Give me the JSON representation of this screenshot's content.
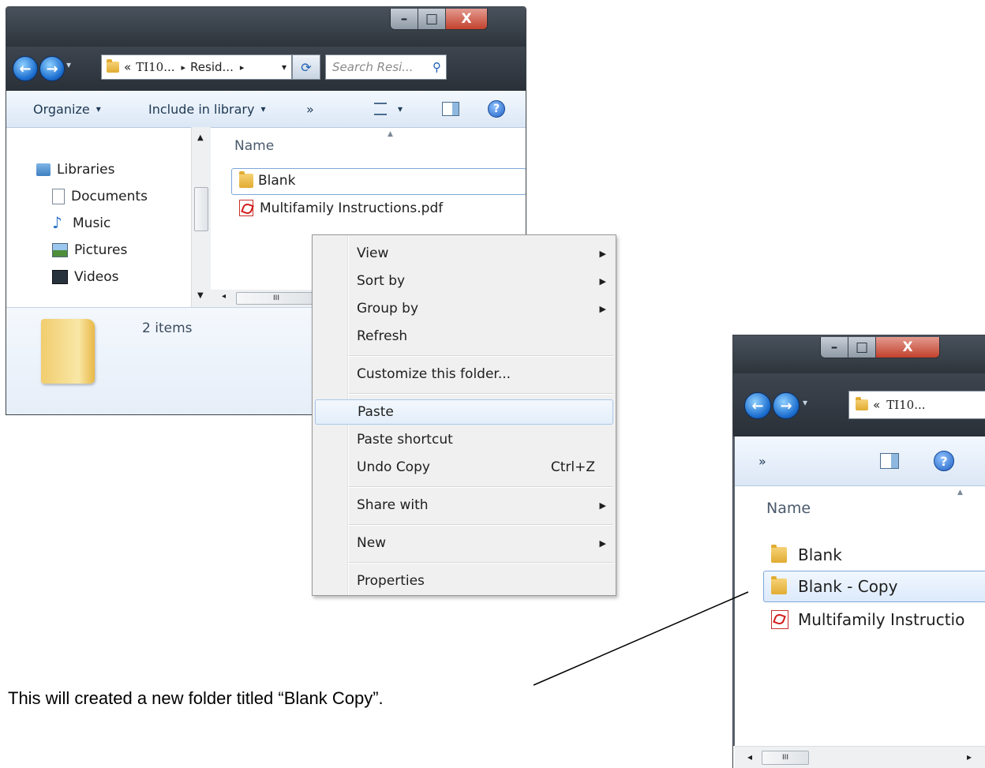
{
  "window_main": {
    "title_buttons": {
      "minimize": "–",
      "maximize": "□",
      "close": "X"
    },
    "address": {
      "chevrons": "«",
      "part1": "TI10...",
      "sep": "▸",
      "part2": "Resid...",
      "sep2": "▸",
      "dropdown": "▾",
      "refresh": "⟳"
    },
    "search_placeholder": "Search Resi...",
    "toolbar": {
      "organize": "Organize",
      "include": "Include in library",
      "more": "»",
      "dd": "▾"
    },
    "nav": {
      "libraries": "Libraries",
      "documents": "Documents",
      "music": "Music",
      "pictures": "Pictures",
      "videos": "Videos"
    },
    "column_name": "Name",
    "files": [
      {
        "name": "Blank",
        "type": "folder"
      },
      {
        "name": "Multifamily Instructions.pdf",
        "type": "pdf"
      }
    ],
    "status_text": "2 items",
    "hscroll_thumb": "III"
  },
  "context_menu": {
    "items": [
      {
        "label": "View",
        "submenu": true
      },
      {
        "label": "Sort by",
        "submenu": true
      },
      {
        "label": "Group by",
        "submenu": true
      },
      {
        "label": "Refresh",
        "submenu": false
      },
      {
        "label": "Customize this folder...",
        "submenu": false
      },
      {
        "label": "Paste",
        "submenu": false,
        "highlighted": true
      },
      {
        "label": "Paste shortcut",
        "submenu": false
      },
      {
        "label": "Undo Copy",
        "shortcut": "Ctrl+Z",
        "submenu": false
      },
      {
        "label": "Share with",
        "submenu": true
      },
      {
        "label": "New",
        "submenu": true
      },
      {
        "label": "Properties",
        "submenu": false
      }
    ],
    "submenu_arrow": "▶"
  },
  "window_result": {
    "title_buttons": {
      "minimize": "–",
      "maximize": "□",
      "close": "X"
    },
    "address": {
      "chevrons": "«",
      "part1": "TI10..."
    },
    "more": "»",
    "column_name": "Name",
    "files": [
      {
        "name": "Blank",
        "type": "folder"
      },
      {
        "name": "Blank - Copy",
        "type": "folder",
        "selected": true
      },
      {
        "name": "Multifamily Instructio",
        "type": "pdf"
      }
    ],
    "hscroll_thumb": "III",
    "left_arrow": "◂",
    "right_arrow": "▸"
  },
  "caption": "This will created a new folder titled “Blank Copy”.",
  "colors": {
    "accent": "#1d6fd0",
    "selection": "#dceafb",
    "titlebar": "#2d343c"
  }
}
